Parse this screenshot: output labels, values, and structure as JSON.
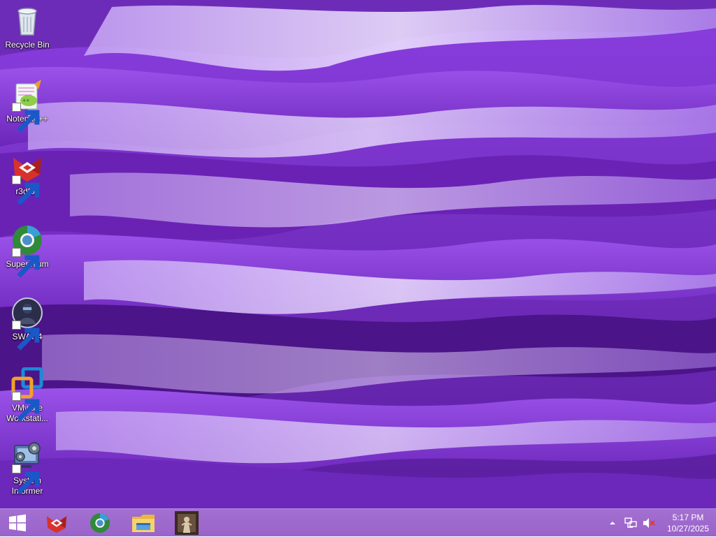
{
  "desktop": {
    "icons": [
      {
        "label": "Recycle Bin",
        "icon": "recycle-bin-icon"
      },
      {
        "label": "Notepad++",
        "icon": "notepad-plus-plus-icon"
      },
      {
        "label": "r3dfox",
        "icon": "r3dfox-icon"
      },
      {
        "label": "Supermium",
        "icon": "supermium-icon"
      },
      {
        "label": "SWAT 4",
        "icon": "swat4-icon"
      },
      {
        "label": "VMware Workstati...",
        "icon": "vmware-icon"
      },
      {
        "label": "System Informer",
        "icon": "system-informer-icon"
      }
    ]
  },
  "taskbar": {
    "pinned": [
      {
        "icon": "r3dfox-icon"
      },
      {
        "icon": "supermium-icon"
      },
      {
        "icon": "file-explorer-icon"
      },
      {
        "icon": "game-icon"
      }
    ],
    "tray": {
      "icons": [
        "show-hidden-icons-icon",
        "network-icon",
        "volume-muted-icon"
      ]
    },
    "clock": {
      "time": "5:17 PM",
      "date": "10/27/2025"
    }
  },
  "colors": {
    "taskbar": "#9a63ca",
    "wallpaper_accent": "#7a2ed4"
  }
}
